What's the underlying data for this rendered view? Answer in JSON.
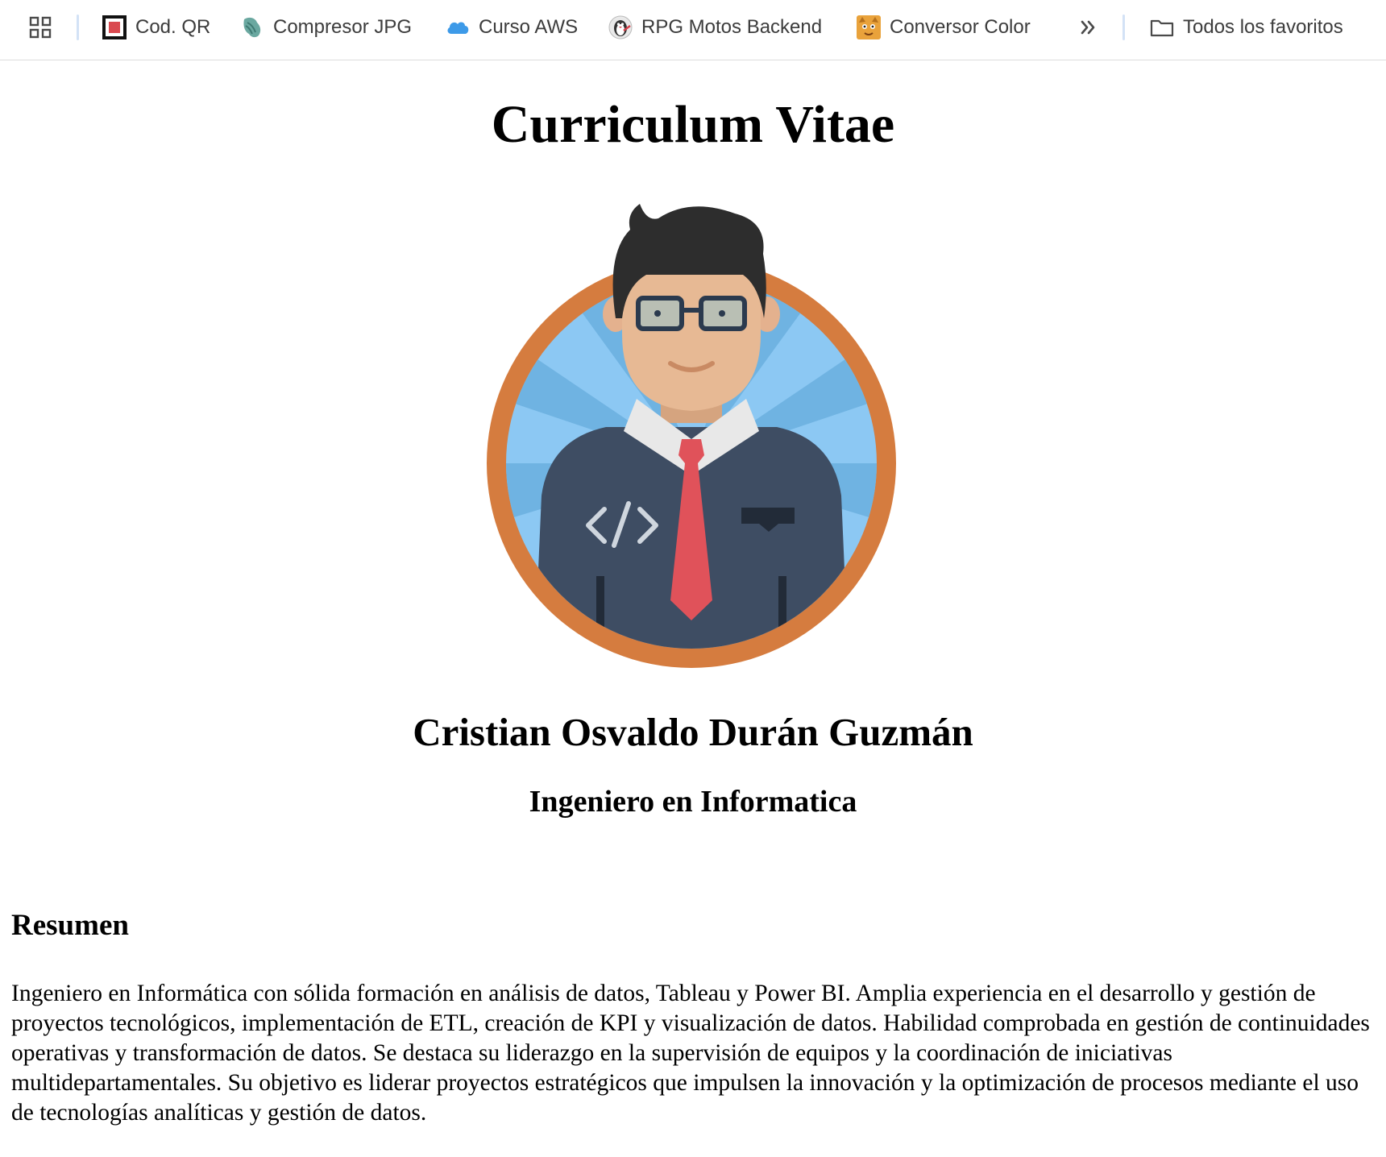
{
  "bookmarks_bar": {
    "apps_icon": "apps-grid-icon",
    "items": [
      {
        "label": "Cod. QR",
        "icon": "qr-code-icon"
      },
      {
        "label": "Compresor JPG",
        "icon": "compressor-icon"
      },
      {
        "label": "Curso AWS",
        "icon": "cloud-icon"
      },
      {
        "label": "RPG Motos Backend",
        "icon": "penguin-icon"
      },
      {
        "label": "Conversor Color",
        "icon": "cat-icon"
      }
    ],
    "overflow_icon": "chevron-double-right-icon",
    "all_bookmarks": {
      "label": "Todos los favoritos",
      "icon": "folder-icon"
    }
  },
  "page": {
    "title": "Curriculum Vitae",
    "avatar_icon": "developer-avatar-icon",
    "name": "Cristian Osvaldo Durán Guzmán",
    "profession": "Ingeniero en Informatica",
    "summary_heading": "Resumen",
    "summary_text": "Ingeniero en Informática con sólida formación en análisis de datos, Tableau y Power BI. Amplia experiencia en el desarrollo y gestión de proyectos tecnológicos, implementación de ETL, creación de KPI y visualización de datos. Habilidad comprobada en gestión de continuidades operativas y transformación de datos. Se destaca su liderazgo en la supervisión de equipos y la coordinación de iniciativas multidepartamentales. Su objetivo es liderar proyectos estratégicos que impulsen la innovación y la optimización de procesos mediante el uso de tecnologías analíticas y gestión de datos."
  },
  "colors": {
    "avatar_ring": "#d57c3f",
    "avatar_sky": "#8cc8f3",
    "suit": "#3e4d63",
    "tie": "#e0525a",
    "separator": "#d3e2f6"
  }
}
